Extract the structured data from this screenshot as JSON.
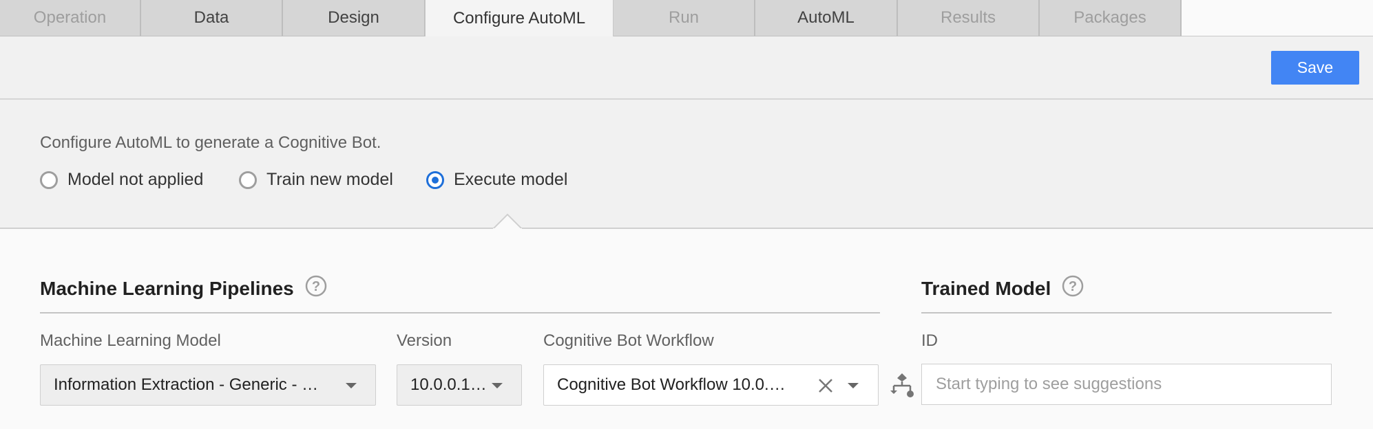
{
  "tabs": [
    {
      "label": "Operation",
      "state": "dim"
    },
    {
      "label": "Data",
      "state": "normal"
    },
    {
      "label": "Design",
      "state": "normal"
    },
    {
      "label": "Configure AutoML",
      "state": "active"
    },
    {
      "label": "Run",
      "state": "dim"
    },
    {
      "label": "AutoML",
      "state": "normal"
    },
    {
      "label": "Results",
      "state": "dim"
    },
    {
      "label": "Packages",
      "state": "dim"
    }
  ],
  "toolbar": {
    "save_label": "Save"
  },
  "config": {
    "description": "Configure AutoML to generate a Cognitive Bot.",
    "options": [
      {
        "label": "Model not applied",
        "checked": false
      },
      {
        "label": "Train new model",
        "checked": false
      },
      {
        "label": "Execute model",
        "checked": true
      }
    ]
  },
  "pipelines": {
    "title": "Machine Learning Pipelines",
    "model_label": "Machine Learning Model",
    "model_value": "Information Extraction - Generic - …",
    "version_label": "Version",
    "version_value": "10.0.0.1…",
    "workflow_label": "Cognitive Bot Workflow",
    "workflow_value": "Cognitive Bot Workflow 10.0.…"
  },
  "trained_model": {
    "title": "Trained Model",
    "id_label": "ID",
    "id_placeholder": "Start typing to see suggestions"
  },
  "colors": {
    "accent": "#4285f4",
    "radio_selected": "#1e6fd9"
  },
  "icons": [
    "help-icon",
    "chevron-down-icon",
    "close-icon",
    "pipeline-icon"
  ]
}
